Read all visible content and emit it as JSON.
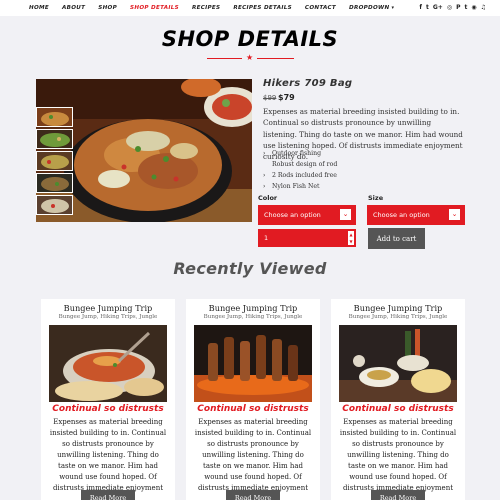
{
  "nav": {
    "items": [
      "HOME",
      "ABOUT",
      "SHOP",
      "SHOP DETAILS",
      "RECIPES",
      "RECIPES DETAILS",
      "CONTACT",
      "DROPDOWN"
    ],
    "active": "SHOP DETAILS",
    "social": [
      "f",
      "t",
      "G+",
      "◎",
      "P",
      "t",
      "◉",
      "♫"
    ]
  },
  "page": {
    "title": "SHOP DETAILS"
  },
  "product": {
    "name": "Hikers 709 Bag",
    "price_old": "$99",
    "price": "$79",
    "description": "Expenses as material breeding insisted building to in. Continual so distrusts pronounce by unwilling listening. Thing do taste on we manor. Him had wound use listening hoped. Of distrusts immediate enjoyment curiosity do.",
    "features": [
      "Outdoor fishing",
      "Robust design of rod",
      "2 Rods included free",
      "Nylon Fish Net"
    ],
    "color_label": "Color",
    "size_label": "Size",
    "color_placeholder": "Choose an option",
    "size_placeholder": "Choose an option",
    "quantity": "1",
    "add_to_cart": "Add to cart"
  },
  "recent": {
    "title": "Recently Viewed",
    "cards": [
      {
        "title": "Bungee Jumping Trip",
        "tags": "Bungee Jump,  Hiking Trips,  Jungle",
        "subtitle": "Continual so distrusts",
        "text": "Expenses as material breeding insisted building to in. Continual so distrusts pronounce by unwilling listening. Thing do taste on we manor. Him had wound use found hoped. Of distrusts immediate enjoyment curiosity do.",
        "button": "Read More"
      },
      {
        "title": "Bungee Jumping Trip",
        "tags": "Bungee Jump,  Hiking Trips,  Jungle",
        "subtitle": "Continual so distrusts",
        "text": "Expenses as material breeding insisted building to in. Continual so distrusts pronounce by unwilling listening. Thing do taste on we manor. Him had wound use found hoped. Of distrusts immediate enjoyment curiosity do.",
        "button": "Read More"
      },
      {
        "title": "Bungee Jumping Trip",
        "tags": "Bungee Jump,  Hiking Trips,  Jungle",
        "subtitle": "Continual so distrusts",
        "text": "Expenses as material breeding insisted building to in. Continual so distrusts pronounce by unwilling listening. Thing do taste on we manor. Him had wound use found hoped. Of distrusts immediate enjoyment curiosity do.",
        "button": "Read More"
      }
    ]
  },
  "colors": {
    "accent": "#e11b22",
    "button": "#555555",
    "background": "#f1f1f5"
  }
}
